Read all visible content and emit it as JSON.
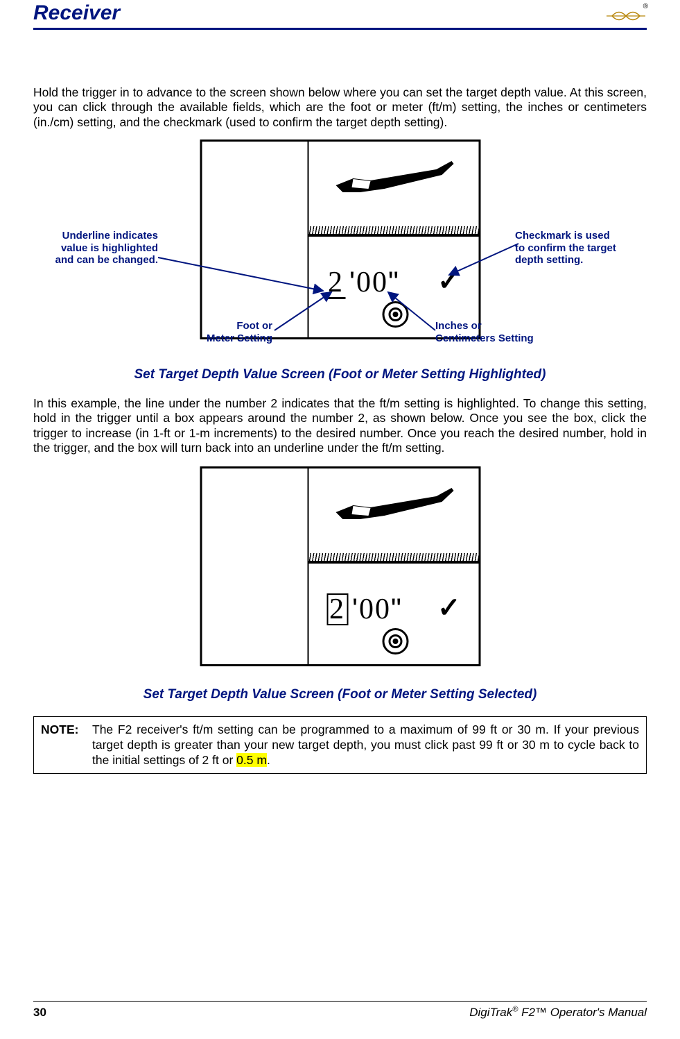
{
  "header": {
    "section_title": "Receiver",
    "logo_trademark": "®"
  },
  "para1": "Hold the trigger in to advance to the screen shown below where you can set the target depth value. At this screen, you can click through the available fields, which are the foot or meter (ft/m) setting, the inches or centimeters (in./cm) setting, and the checkmark (used to confirm the target depth setting).",
  "figure1": {
    "callout_underline_1": "Underline indicates",
    "callout_underline_2": "value is highlighted",
    "callout_underline_3": "and can be changed.",
    "callout_footmeter_1": "Foot or",
    "callout_footmeter_2": "Meter Setting",
    "callout_check_1": "Checkmark is used",
    "callout_check_2": "to confirm the target",
    "callout_check_3": "depth setting.",
    "callout_inches_1": "Inches or",
    "callout_inches_2": "Centimeters Setting",
    "display_feet": "2",
    "display_feet_mark": "'",
    "display_inches": "00",
    "display_inches_mark": "\"",
    "display_check": "✓",
    "caption": "Set Target Depth Value Screen (Foot or Meter Setting Highlighted)"
  },
  "para2": "In this example, the line under the number 2 indicates that the ft/m setting is highlighted. To change this setting, hold in the trigger until a box appears around the number 2, as shown below. Once you see the box, click the trigger to increase (in 1-ft or 1-m increments) to the desired number. Once you reach the desired number, hold in the trigger, and the box will turn back into an underline under the ft/m setting.",
  "figure2": {
    "display_feet": "2",
    "display_feet_mark": "'",
    "display_inches": "00",
    "display_inches_mark": "\"",
    "display_check": "✓",
    "caption": "Set Target Depth Value Screen (Foot or Meter Setting Selected)"
  },
  "note": {
    "label": "NOTE",
    "text_before_highlight": "The F2 receiver's ft/m setting can be programmed to a maximum of 99 ft or 30 m. If your previous target depth is greater than your new target depth, you must click past 99 ft or 30 m to cycle back to the initial settings of 2 ft or ",
    "highlight": "0.5 m",
    "text_after_highlight": "."
  },
  "footer": {
    "page_number": "30",
    "manual_prefix": "DigiTrak",
    "manual_reg": "®",
    "manual_mid": " F2™ ",
    "manual_suffix": "Operator's Manual"
  }
}
